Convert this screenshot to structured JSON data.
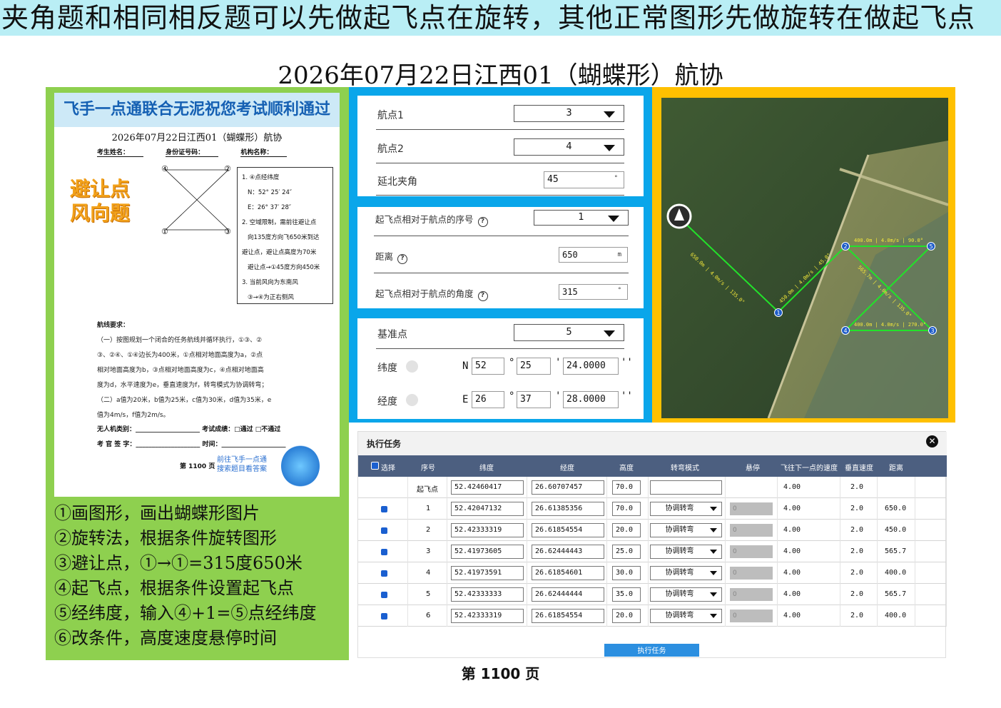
{
  "banner": "夹角题和相同相反题可以先做起飞点在旋转，其他正常图形先做旋转在做起飞点",
  "title": "2026年07月22日江西01（蝴蝶形）航协",
  "sheet": {
    "header": "飞手一点通联合无泥祝您考试顺利通过",
    "subtitle": "2026年07月22日江西01（蝴蝶形）航协",
    "fields": [
      "考生姓名：",
      "身份证号码：",
      "机构名称："
    ],
    "avoid_label_1": "避让点",
    "avoid_label_2": "风向题",
    "diagram_points": [
      "④",
      "②",
      "①",
      "③"
    ],
    "notes": [
      "1. ④点经纬度",
      "N：52° 25′ 24″",
      "E：26° 37′ 28″",
      "2. 空域限制，需前往避让点",
      "向135度方向飞650米到达",
      "避让点，避让点高度为70米",
      "避让点→①45度方向450米",
      "3. 当前风向为东南风",
      "③→④为正右侧风"
    ],
    "req_title": "航线要求：",
    "req_lines": [
      "（一）按图规划一个闭合的任务航线并循环执行，①③、②",
      "③、②④、①④边长为400米，①点相对地面高度为a，②点",
      "相对地面高度为b，③点相对地面高度为c，④点相对地面高",
      "度为d，水平速度为e，垂直速度为f，转弯模式为协调转弯；",
      "（二）a值为20米，b值为25米，c值为30米，d值为35米，e",
      "值为4m/s，f值为2m/s。"
    ],
    "sign_lines": [
      "无人机类别：____________________ 考试成绩：□通过  □不通过",
      "考 官 签 字：____________________ 时间：____________________"
    ],
    "promo_1": "前往飞手一点通",
    "promo_2": "搜索题目看答案",
    "page": "第 1100 页"
  },
  "steps": [
    "①画图形，画出蝴蝶形图片",
    "②旋转法，根据条件旋转图形",
    "③避让点，①→①=315度650米",
    "④起飞点，根据条件设置起飞点",
    "⑤经纬度，输入④+1=⑤点经纬度",
    "⑥改条件，高度速度悬停时间"
  ],
  "rotate": {
    "label_p1": "航点1",
    "value_p1": "3",
    "label_p2": "航点2",
    "value_p2": "4",
    "label_angle": "延北夹角",
    "value_angle": "45",
    "unit_angle": "°"
  },
  "takeoff": {
    "label_seq": "起飞点相对于航点的序号",
    "value_seq": "1",
    "label_dist": "距离",
    "value_dist": "650",
    "unit_dist": "m",
    "label_angle": "起飞点相对于航点的角度",
    "value_angle": "315",
    "unit_angle": "°"
  },
  "coord": {
    "label_base": "基准点",
    "value_base": "5",
    "label_lat": "纬度",
    "lat_dir": "N",
    "lat_deg": "52",
    "lat_min": "25",
    "lat_sec": "24.0000",
    "label_lon": "经度",
    "lon_dir": "E",
    "lon_deg": "26",
    "lon_min": "37",
    "lon_sec": "28.0000"
  },
  "map": {
    "legs": [
      "650.0m | 4.0m/s | 135.0°",
      "450.0m | 4.0m/s | 45.0°",
      "400.0m | 4.0m/s | 90.0°",
      "565.7m | 4.0m/s | 135.0°",
      "400.0m | 4.0m/s | 270.0°"
    ]
  },
  "task": {
    "title": "执行任务",
    "headers": [
      "选择",
      "序号",
      "纬度",
      "经度",
      "高度",
      "转弯模式",
      "悬停",
      "飞往下一点的速度",
      "垂直速度",
      "距离"
    ],
    "rows": [
      {
        "seq": "起飞点",
        "lat": "52.42460417",
        "lon": "26.60707457",
        "alt": "70.0",
        "turn": "",
        "hover": "",
        "speed": "4.00",
        "vspeed": "2.0",
        "dist": ""
      },
      {
        "seq": "1",
        "lat": "52.42047132",
        "lon": "26.61385356",
        "alt": "70.0",
        "turn": "协调转弯",
        "hover": "0",
        "speed": "4.00",
        "vspeed": "2.0",
        "dist": "650.0"
      },
      {
        "seq": "2",
        "lat": "52.42333319",
        "lon": "26.61854554",
        "alt": "20.0",
        "turn": "协调转弯",
        "hover": "0",
        "speed": "4.00",
        "vspeed": "2.0",
        "dist": "450.0"
      },
      {
        "seq": "3",
        "lat": "52.41973605",
        "lon": "26.62444443",
        "alt": "25.0",
        "turn": "协调转弯",
        "hover": "0",
        "speed": "4.00",
        "vspeed": "2.0",
        "dist": "565.7"
      },
      {
        "seq": "4",
        "lat": "52.41973591",
        "lon": "26.61854601",
        "alt": "30.0",
        "turn": "协调转弯",
        "hover": "0",
        "speed": "4.00",
        "vspeed": "2.0",
        "dist": "400.0"
      },
      {
        "seq": "5",
        "lat": "52.42333333",
        "lon": "26.62444444",
        "alt": "35.0",
        "turn": "协调转弯",
        "hover": "0",
        "speed": "4.00",
        "vspeed": "2.0",
        "dist": "565.7"
      },
      {
        "seq": "6",
        "lat": "52.42333319",
        "lon": "26.61854554",
        "alt": "20.0",
        "turn": "协调转弯",
        "hover": "0",
        "speed": "4.00",
        "vspeed": "2.0",
        "dist": "400.0"
      }
    ],
    "execute": "执行任务"
  },
  "page_footer": "第 1100 页",
  "colors": {
    "green": "#8ed04f",
    "blue": "#0aa6ea",
    "yellow": "#ffc000",
    "table_header": "#4c5f80"
  }
}
